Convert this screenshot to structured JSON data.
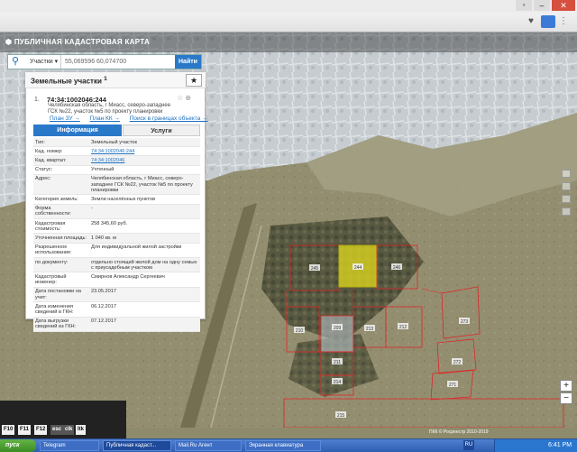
{
  "app": {
    "title": "ПУБЛИЧНАЯ КАДАСТРОВАЯ КАРТА"
  },
  "search": {
    "type_label": "Участки",
    "value": "55,069596 60,074700",
    "button_label": "Найти"
  },
  "panel": {
    "title": "Земельные участки",
    "count": "1",
    "item_number": "1.",
    "cadastral_number": "74:34:1002046:244",
    "address_lines": [
      "Челябинская область, г Миасс, северо-западнее",
      "ГСК №22, участок №5 по проекту планировки"
    ],
    "links": [
      "План ЗУ →",
      "План КК →",
      "Поиск в границах объекта →"
    ],
    "tabs": {
      "info": "Информация",
      "services": "Услуги"
    },
    "properties": [
      {
        "key": "Тип:",
        "value": "Земельный участок",
        "link": false
      },
      {
        "key": "Кад. номер:",
        "value": "74:34:1002046:244",
        "link": true
      },
      {
        "key": "Кад. квартал:",
        "value": "74:34:1002046",
        "link": true
      },
      {
        "key": "Статус:",
        "value": "Учтенный",
        "link": false
      },
      {
        "key": "Адрес:",
        "value": "Челябинская область, г Миасс, северо-западнее ГСК №22, участок №5 по проекту планировки",
        "link": false
      },
      {
        "key": "Категория земель:",
        "value": "Земли населённых пунктов",
        "link": false
      },
      {
        "key": "Форма собственности:",
        "value": "-",
        "link": false
      },
      {
        "key": "Кадастровая стоимость:",
        "value": "258 345,60 руб.",
        "link": false
      },
      {
        "key": "Уточненная площадь:",
        "value": "1 040 кв. м",
        "link": false
      },
      {
        "key": "Разрешенное использование:",
        "value": "Для индивидуальной жилой застройки",
        "link": false
      },
      {
        "key": "по документу:",
        "value": "отдельно стоящий жилой дом на одну семью с приусадебным участком",
        "link": false
      },
      {
        "key": "Кадастровый инженер:",
        "value": "Смирнов Александр Сергеевич",
        "link": false
      },
      {
        "key": "Дата постановки на учет:",
        "value": "23.05.2017",
        "link": false
      },
      {
        "key": "Дата изменения сведений в ГКН:",
        "value": "06.12.2017",
        "link": false
      },
      {
        "key": "Дата выгрузки сведений из ГКН:",
        "value": "07.12.2017",
        "link": false
      }
    ]
  },
  "map": {
    "parcel_labels": [
      "245",
      "244",
      "246",
      "210",
      "209",
      "213",
      "212",
      "211",
      "214",
      "215",
      "273",
      "272",
      "271"
    ],
    "copyright": "ПКК © Росреестр 2010-2019",
    "accent_color": "#e0262b",
    "selected_color": "#d8d21e"
  },
  "fkeys": {
    "keys": [
      "F10",
      "F11",
      "F12",
      "esc",
      "clk",
      "ltk"
    ]
  },
  "taskbar": {
    "start_label": "пуск",
    "tasks": [
      "Telegram",
      "Публичная кадаст...",
      "Mail.Ru Агент",
      "Экранная клавиатура"
    ],
    "lang": "RU",
    "clock": "6:41 PM"
  }
}
